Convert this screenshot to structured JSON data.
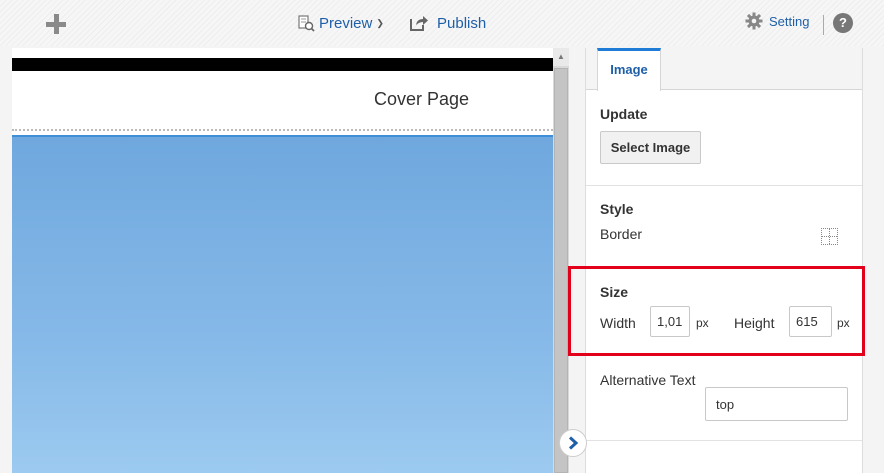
{
  "toolbar": {
    "add_icon": "plus-icon",
    "preview_label": "Preview",
    "preview_icon": "preview-icon",
    "publish_label": "Publish",
    "publish_icon": "publish-icon",
    "setting_label": "Setting",
    "setting_icon": "gear-icon",
    "help_label": "?",
    "link_color": "#1f5fa8"
  },
  "canvas": {
    "cover_title": "Cover Page",
    "image_colors": [
      "#6fa8de",
      "#9ccaf0"
    ]
  },
  "panel": {
    "tab_label": "Image",
    "tab_accent": "#1f7cd6",
    "update": {
      "title": "Update",
      "select_button": "Select Image"
    },
    "style": {
      "title": "Style",
      "border_label": "Border"
    },
    "size": {
      "title": "Size",
      "width_label": "Width",
      "width_value": "1,01",
      "width_unit": "px",
      "height_label": "Height",
      "height_value": "615",
      "height_unit": "px"
    },
    "alt_text": {
      "label": "Alternative Text",
      "value": "top"
    }
  },
  "highlight_color": "#e3001b"
}
